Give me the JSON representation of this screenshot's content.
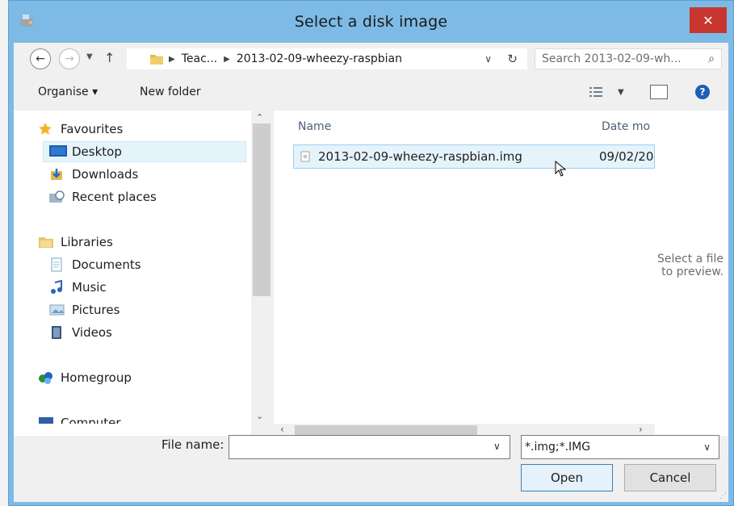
{
  "window": {
    "title": "Select a disk image",
    "close_glyph": "✕"
  },
  "address": {
    "path": [
      "Teac...",
      "2013-02-09-wheezy-raspbian"
    ],
    "search_placeholder": "Search 2013-02-09-wh..."
  },
  "toolbar": {
    "organise": "Organise ▾",
    "new_folder": "New folder"
  },
  "nav": {
    "favourites": "Favourites",
    "desktop": "Desktop",
    "downloads": "Downloads",
    "recent": "Recent places",
    "libraries": "Libraries",
    "documents": "Documents",
    "music": "Music",
    "pictures": "Pictures",
    "videos": "Videos",
    "homegroup": "Homegroup",
    "computer": "Computer"
  },
  "list": {
    "col_name": "Name",
    "col_date": "Date mo",
    "files": [
      {
        "name": "2013-02-09-wheezy-raspbian.img",
        "date": "09/02/20"
      }
    ]
  },
  "preview_text": [
    "Select a file",
    "to preview."
  ],
  "bottom": {
    "file_name_label": "File name:",
    "file_name_value": "",
    "filter_value": "*.img;*.IMG",
    "open": "Open",
    "cancel": "Cancel"
  },
  "colors": {
    "titlebar": "#7dbbe6",
    "close": "#c7372f",
    "selection": "#e5f3fb"
  }
}
